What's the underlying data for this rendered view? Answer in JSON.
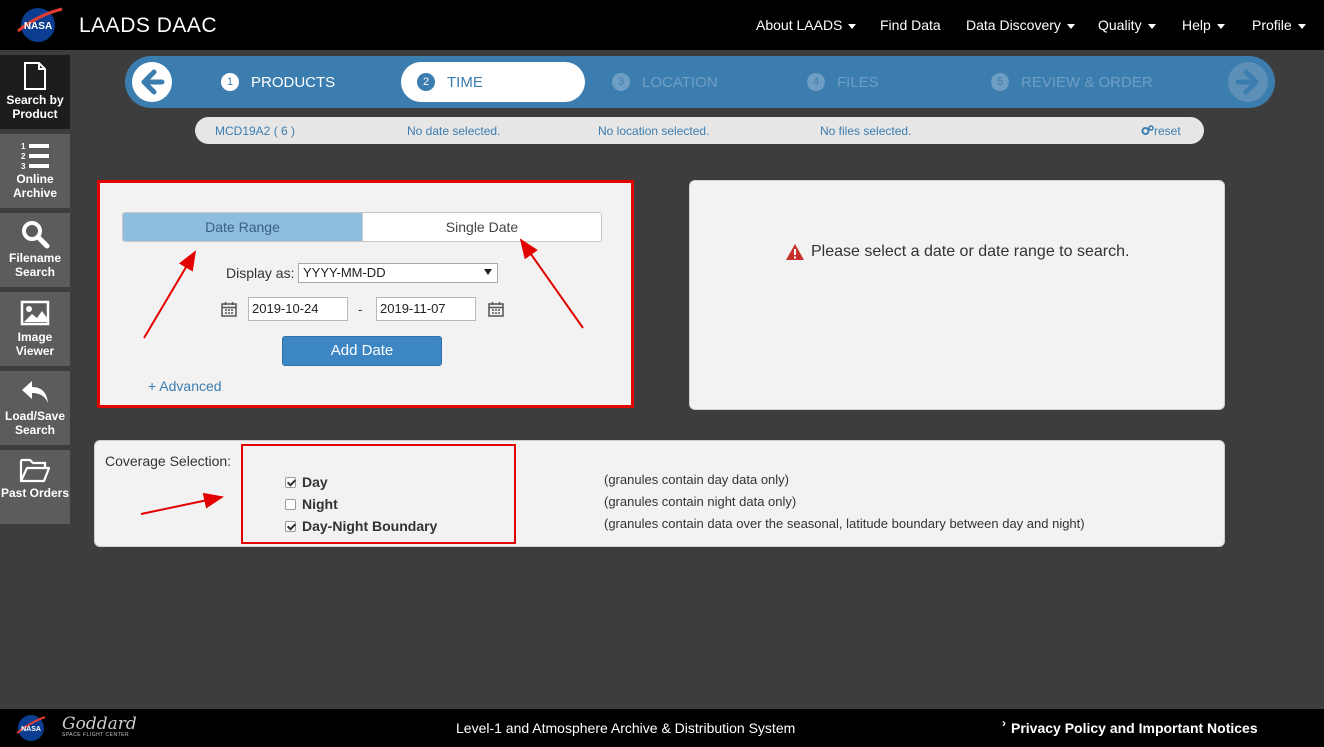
{
  "header": {
    "app_title": "LAADS DAAC",
    "nav": [
      "About LAADS",
      "Find Data",
      "Data Discovery",
      "Quality",
      "Help",
      "Profile"
    ],
    "logo_text": "NASA"
  },
  "sidebar": {
    "items": [
      {
        "label_1": "Search by",
        "label_2": "Product",
        "icon": "document-icon"
      },
      {
        "label_1": "Online",
        "label_2": "Archive",
        "icon": "numbered-list-icon"
      },
      {
        "label_1": "Filename",
        "label_2": "Search",
        "icon": "search-icon"
      },
      {
        "label_1": "Image",
        "label_2": "Viewer",
        "icon": "image-icon"
      },
      {
        "label_1": "Load/Save",
        "label_2": "Search",
        "icon": "reply-icon"
      },
      {
        "label_1": "Past Orders",
        "label_2": "",
        "icon": "folder-open-icon"
      }
    ]
  },
  "wizard": {
    "steps": [
      {
        "num": "1",
        "label": "PRODUCTS"
      },
      {
        "num": "2",
        "label": "TIME"
      },
      {
        "num": "3",
        "label": "LOCATION"
      },
      {
        "num": "4",
        "label": "FILES"
      },
      {
        "num": "5",
        "label": "REVIEW & ORDER"
      }
    ]
  },
  "summary": {
    "product": "MCD19A2 ( 6 )",
    "date": "No date selected.",
    "location": "No location selected.",
    "files": "No files selected.",
    "reset": "reset"
  },
  "date_panel": {
    "tab_range": "Date Range",
    "tab_single": "Single Date",
    "display_as_label": "Display as:",
    "display_format": "YYYY-MM-DD",
    "start_date": "2019-10-24",
    "end_date": "2019-11-07",
    "separator": "-",
    "add_button": "Add Date",
    "advanced_link": "+ Advanced"
  },
  "message_panel": {
    "text": "Please select a date or date range to search."
  },
  "coverage": {
    "label": "Coverage Selection:",
    "options": [
      {
        "label": "Day",
        "checked": true,
        "desc": "(granules contain day data only)"
      },
      {
        "label": "Night",
        "checked": false,
        "desc": "(granules contain night data only)"
      },
      {
        "label": "Day-Night Boundary",
        "checked": true,
        "desc": "(granules contain data over the seasonal, latitude boundary between day and night)"
      }
    ]
  },
  "footer": {
    "goddard": "Goddard",
    "goddard_sub": "SPACE FLIGHT CENTER",
    "center_text": "Level-1 and Atmosphere Archive & Distribution System",
    "privacy": "Privacy Policy and Important Notices"
  },
  "colors": {
    "accent": "#3c7db0",
    "annotation": "#e30000",
    "button": "#3c86c4"
  }
}
